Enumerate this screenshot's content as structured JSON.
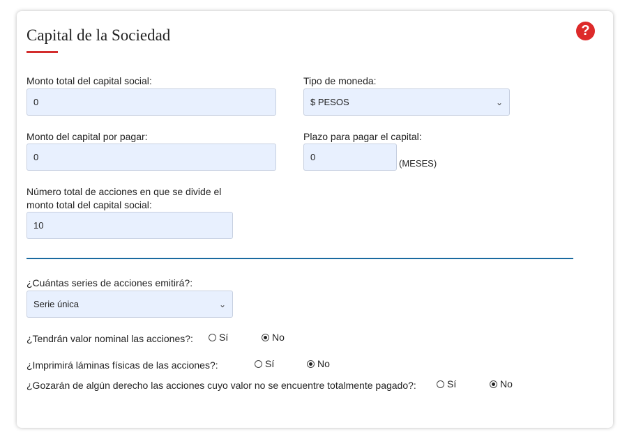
{
  "card": {
    "title": "Capital de la Sociedad",
    "help_glyph": "?"
  },
  "fields": {
    "capital_total": {
      "label": "Monto total del capital social:",
      "value": "0"
    },
    "moneda": {
      "label": "Tipo de moneda:",
      "selected": "$ PESOS"
    },
    "capital_por_pagar": {
      "label": "Monto del capital por pagar:",
      "value": "0"
    },
    "plazo": {
      "label": "Plazo para pagar el capital:",
      "value": "0",
      "unit": "(MESES)"
    },
    "acciones": {
      "label_line1": "Número total de acciones en que se divide el",
      "label_line2": "monto total del capital social:",
      "value": "10"
    },
    "series": {
      "label": "¿Cuántas series de acciones emitirá?:",
      "selected": "Serie única"
    }
  },
  "questions": [
    {
      "label": "¿Tendrán valor nominal las acciones?:",
      "options": [
        "Sí",
        "No"
      ],
      "selected": "No"
    },
    {
      "label": "¿Imprimirá láminas físicas de las acciones?:",
      "options": [
        "Sí",
        "No"
      ],
      "selected": "No"
    },
    {
      "label": "¿Gozarán de algún derecho las acciones cuyo valor no se encuentre totalmente pagado?:",
      "options": [
        "Sí",
        "No"
      ],
      "selected": "No"
    }
  ],
  "colors": {
    "accent_red": "#d32d2d",
    "help_red": "#dd2a2a",
    "divider_blue": "#1a6aa0",
    "input_bg": "#e8f0fe"
  },
  "icons": {
    "help": "question-circle-icon",
    "dropdown": "chevron-down-icon"
  }
}
